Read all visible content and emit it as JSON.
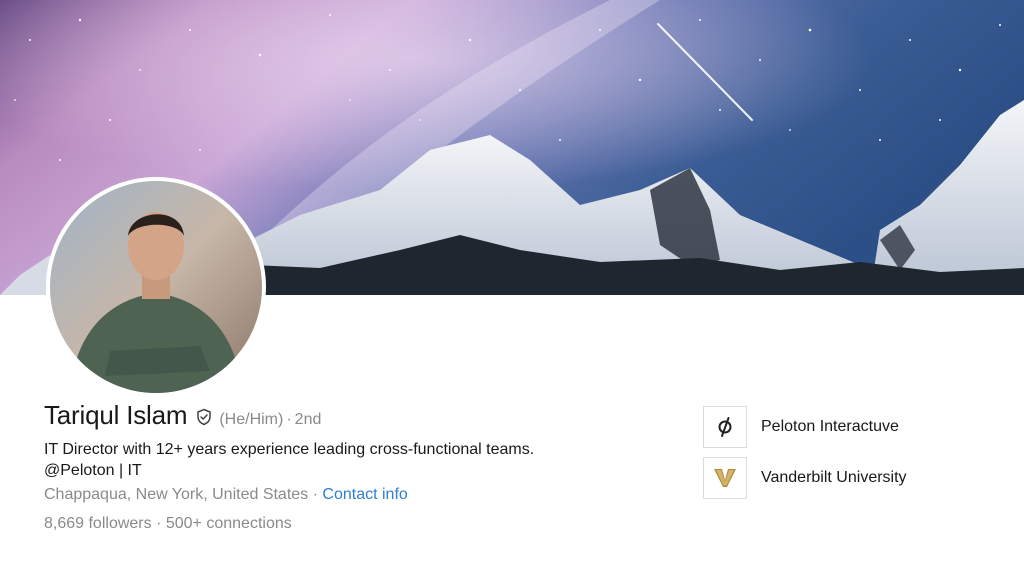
{
  "profile": {
    "name": "Tariqul Islam",
    "pronouns": "(He/Him)",
    "separator": "·",
    "degree": "2nd",
    "headline_line1": "IT Director with 12+ years experience leading cross-functional teams.",
    "headline_line2": "@Peloton | IT",
    "location": "Chappaqua, New York, United States",
    "contact_label": "Contact info",
    "followers": "8,669 followers",
    "connections": "500+ connections"
  },
  "organizations": [
    {
      "name": "Peloton Interactuve",
      "icon": "peloton-logo-icon"
    },
    {
      "name": "Vanderbilt University",
      "icon": "vanderbilt-logo-icon"
    }
  ],
  "colors": {
    "link": "#2f7fd1",
    "muted": "#8a8a8a",
    "text": "#191919",
    "vanderbilt_gold": "#b08a3e"
  }
}
